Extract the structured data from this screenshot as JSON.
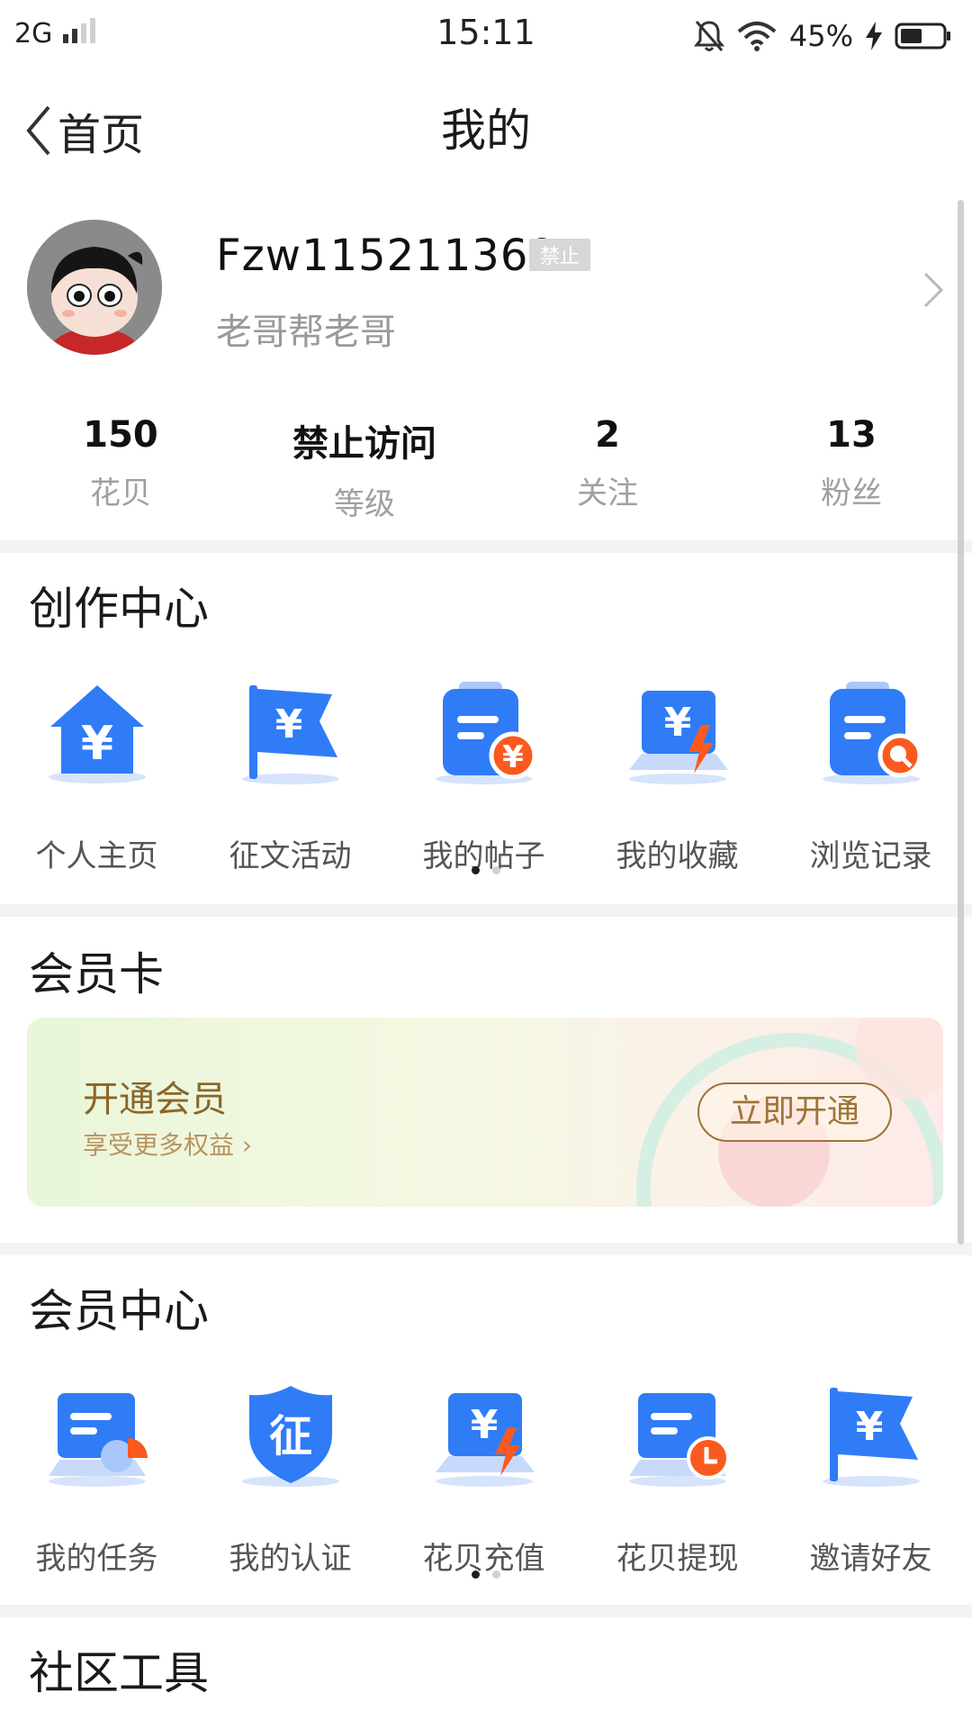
{
  "status_bar": {
    "network": "2G",
    "time": "15:11",
    "battery_percent": "45%"
  },
  "header": {
    "back_label": "首页",
    "title": "我的"
  },
  "profile": {
    "username": "Fzw115211369",
    "badge": "禁止",
    "subtitle": "老哥帮老哥"
  },
  "stats": [
    {
      "value": "150",
      "label": "花贝"
    },
    {
      "value": "禁止访问",
      "label": "等级"
    },
    {
      "value": "2",
      "label": "关注"
    },
    {
      "value": "13",
      "label": "粉丝"
    }
  ],
  "creation_center": {
    "title": "创作中心",
    "items": [
      {
        "label": "个人主页",
        "icon": "home-yen-icon"
      },
      {
        "label": "征文活动",
        "icon": "flag-yen-icon"
      },
      {
        "label": "我的帖子",
        "icon": "clipboard-yen-icon"
      },
      {
        "label": "我的收藏",
        "icon": "laptop-yen-bolt-icon"
      },
      {
        "label": "浏览记录",
        "icon": "clipboard-search-icon"
      }
    ]
  },
  "member_card": {
    "title": "会员卡",
    "heading": "开通会员",
    "sub": "享受更多权益 ›",
    "button": "立即开通"
  },
  "member_center": {
    "title": "会员中心",
    "items": [
      {
        "label": "我的任务",
        "icon": "task-card-icon"
      },
      {
        "label": "我的认证",
        "icon": "shield-zheng-icon"
      },
      {
        "label": "花贝充值",
        "icon": "laptop-yen-bolt-icon"
      },
      {
        "label": "花贝提现",
        "icon": "card-clock-icon"
      },
      {
        "label": "邀请好友",
        "icon": "flag-yen-icon"
      }
    ],
    "zheng_char": "征",
    "yen": "¥"
  },
  "community_tools": {
    "title": "社区工具"
  },
  "colors": {
    "accent_blue": "#2f7cf6",
    "accent_orange": "#fa5a1e",
    "gold": "#9d7437"
  }
}
